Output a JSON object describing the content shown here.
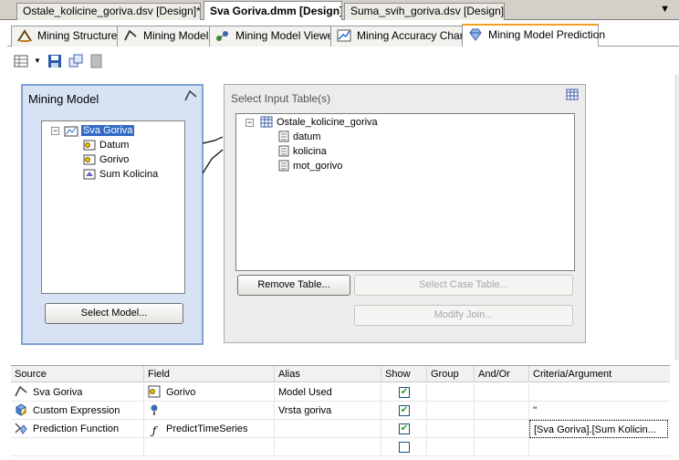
{
  "document_tabs": [
    {
      "label": "Ostale_kolicine_goriva.dsv [Design]*",
      "active": false
    },
    {
      "label": "Sva Goriva.dmm [Design]",
      "active": true
    },
    {
      "label": "Suma_svih_goriva.dsv [Design]",
      "active": false
    }
  ],
  "designer_tabs": [
    {
      "label": "Mining Structure",
      "icon": "mining-structure-icon"
    },
    {
      "label": "Mining Models",
      "icon": "mining-models-icon"
    },
    {
      "label": "Mining Model Viewer",
      "icon": "model-viewer-icon"
    },
    {
      "label": "Mining Accuracy Chart",
      "icon": "accuracy-chart-icon"
    },
    {
      "label": "Mining Model Prediction",
      "icon": "prediction-icon",
      "active": true
    }
  ],
  "mining_model": {
    "title": "Mining Model",
    "model_name": "Sva Goriva",
    "columns": [
      "Datum",
      "Gorivo",
      "Sum Kolicina"
    ],
    "select_button": "Select Model..."
  },
  "input_table": {
    "title": "Select Input Table(s)",
    "table_name": "Ostale_kolicine_goriva",
    "columns": [
      "datum",
      "kolicina",
      "mot_gorivo"
    ],
    "remove_button": "Remove Table...",
    "select_case_button": "Select Case Table...",
    "modify_join_button": "Modify Join..."
  },
  "grid": {
    "headers": [
      "Source",
      "Field",
      "Alias",
      "Show",
      "Group",
      "And/Or",
      "Criteria/Argument"
    ],
    "rows": [
      {
        "source": "Sva Goriva",
        "field": "Gorivo",
        "alias": "Model Used",
        "show": true,
        "criteria": ""
      },
      {
        "source": "Custom Expression",
        "field": "",
        "alias": "Vrsta goriva",
        "show": true,
        "criteria": "''"
      },
      {
        "source": "Prediction Function",
        "field": "PredictTimeSeries",
        "alias": "",
        "show": true,
        "criteria": "[Sva Goriva].[Sum Kolicin..."
      },
      {
        "source": "",
        "field": "",
        "alias": "",
        "show": false,
        "criteria": ""
      }
    ]
  },
  "colors": {
    "accent": "#316ac5",
    "panel_blue": "#d7e3f4",
    "tab_highlight": "#f0a020"
  }
}
